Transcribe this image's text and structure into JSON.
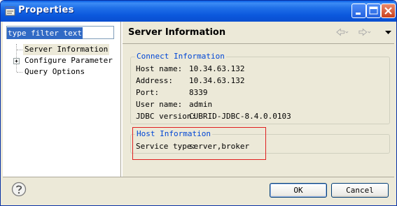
{
  "window": {
    "title": "Properties"
  },
  "filter": {
    "value": "type filter text"
  },
  "tree": {
    "items": [
      {
        "label": "Server Information",
        "selected": true,
        "expandable": false
      },
      {
        "label": "Configure Parameter",
        "selected": false,
        "expandable": true
      },
      {
        "label": "Query Options",
        "selected": false,
        "expandable": false
      }
    ]
  },
  "page": {
    "title": "Server Information",
    "back_icon": "back-arrow-icon",
    "forward_icon": "forward-arrow-icon",
    "menu_icon": "view-menu-icon"
  },
  "connect": {
    "legend": "Connect Information",
    "rows": [
      {
        "key": "Host name:",
        "value": "10.34.63.132"
      },
      {
        "key": "Address:",
        "value": "10.34.63.132"
      },
      {
        "key": "Port:",
        "value": "8339"
      },
      {
        "key": "User name:",
        "value": "admin"
      },
      {
        "key": "JDBC version:",
        "value": "CUBRID-JDBC-8.4.0.0103"
      }
    ]
  },
  "host": {
    "legend": "Host Information",
    "rows": [
      {
        "key": "Service type:",
        "value": "server,broker"
      }
    ]
  },
  "buttons": {
    "ok": "OK",
    "cancel": "Cancel"
  },
  "colors": {
    "titlebar": "#0a58dd",
    "legend": "#0046d5",
    "highlight": "#e02020"
  }
}
